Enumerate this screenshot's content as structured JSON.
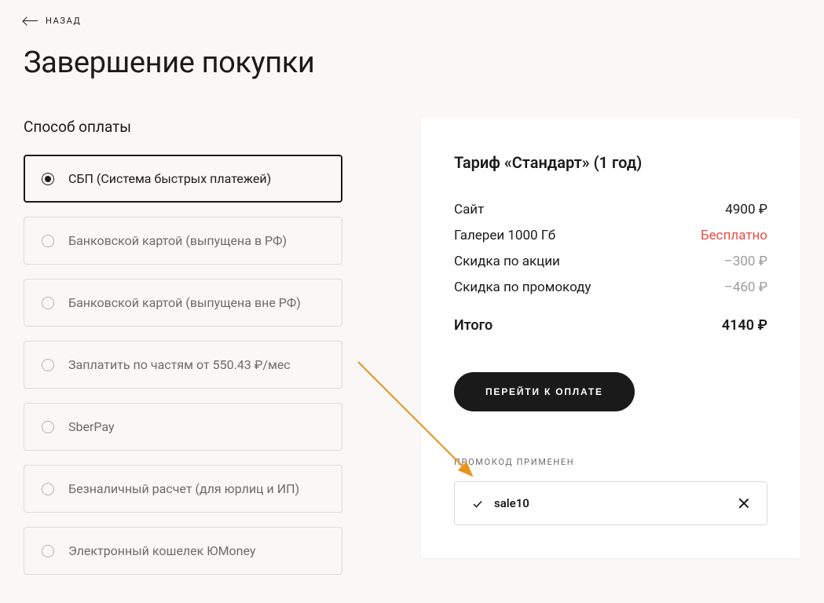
{
  "back_label": "НАЗАД",
  "page_title": "Завершение покупки",
  "payment_section_title": "Способ оплаты",
  "payment_methods": [
    {
      "label": "СБП (Система быстрых платежей)",
      "selected": true
    },
    {
      "label": "Банковской картой (выпущена в РФ)",
      "selected": false
    },
    {
      "label": "Банковской картой (выпущена вне РФ)",
      "selected": false
    },
    {
      "label": "Заплатить по частям от 550.43 ₽/мес",
      "selected": false
    },
    {
      "label": "SberPay",
      "selected": false
    },
    {
      "label": "Безналичный расчет (для юрлиц и ИП)",
      "selected": false
    },
    {
      "label": "Электронный кошелек ЮMoney",
      "selected": false
    }
  ],
  "summary": {
    "tariff_title": "Тариф «Стандарт» (1 год)",
    "rows": [
      {
        "label": "Сайт",
        "value": "4900 ₽",
        "value_class": ""
      },
      {
        "label": "Галереи 1000 Гб",
        "value": "Бесплатно",
        "value_class": "red"
      },
      {
        "label": "Скидка по акции",
        "value": "–300 ₽",
        "value_class": "gray"
      },
      {
        "label": "Скидка по промокоду",
        "value": "–460 ₽",
        "value_class": "gray"
      }
    ],
    "total_label": "Итого",
    "total_value": "4140 ₽",
    "pay_button_label": "ПЕРЕЙТИ К ОПЛАТЕ"
  },
  "promo": {
    "applied_label": "ПРОМОКОД ПРИМЕНЕН",
    "code": "sale10"
  }
}
